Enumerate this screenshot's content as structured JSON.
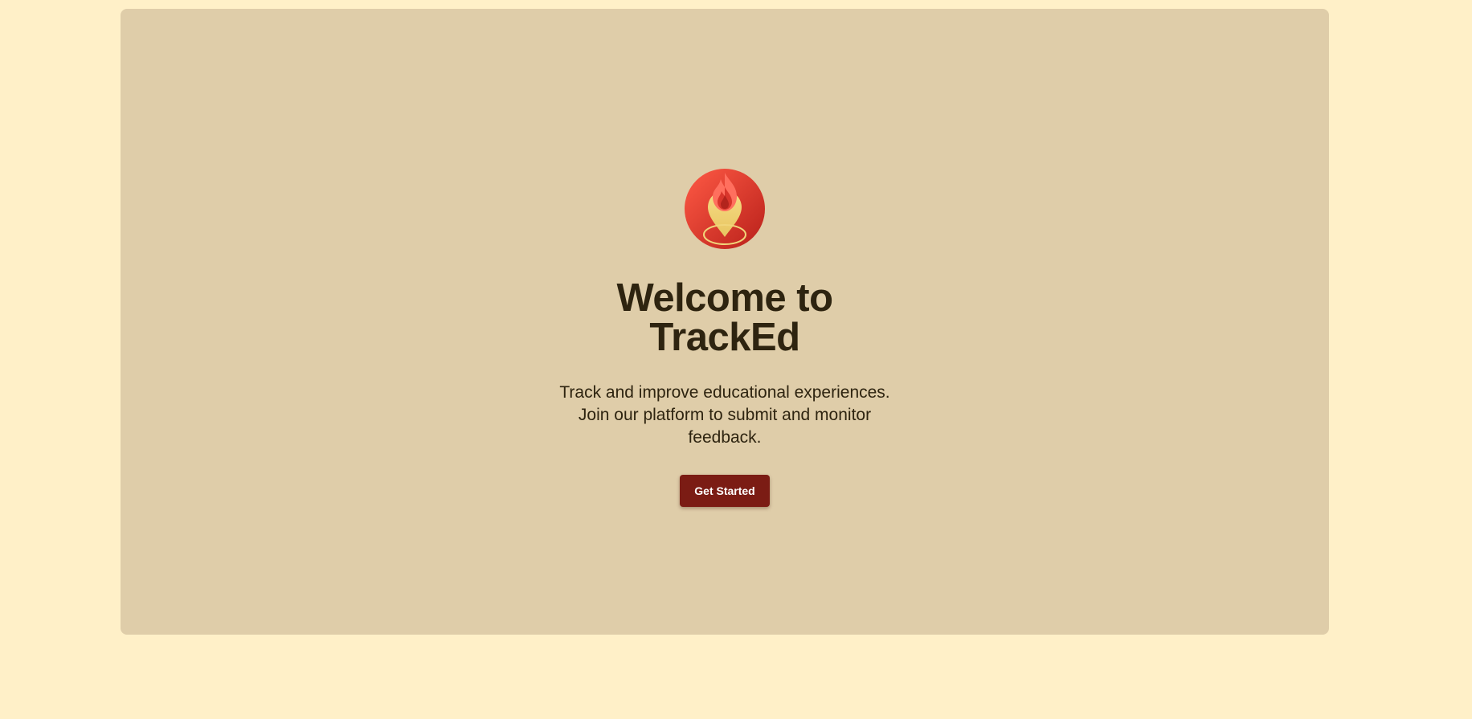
{
  "hero": {
    "logo_icon": "flame-map-pin-icon",
    "title": "Welcome to TrackEd",
    "subtitle": "Track and improve educational experiences. Join our platform to submit and monitor feedback.",
    "cta_label": "Get Started"
  },
  "colors": {
    "page_background": "#fff0c8",
    "card_background": "#dfcda9",
    "text": "#2e2410",
    "button": "#7b1c14",
    "logo_red": "#e53a2f",
    "logo_gold": "#f1d57a"
  }
}
